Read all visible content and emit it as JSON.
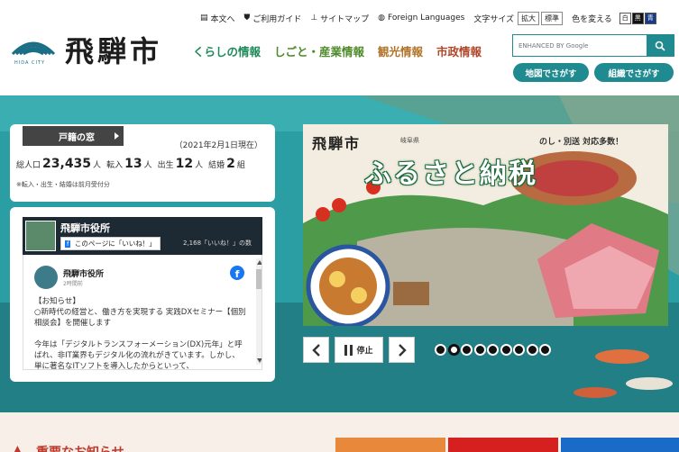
{
  "header": {
    "logo_text": "飛騨市",
    "logo_sub": "HIDA CITY",
    "util": {
      "text_link": "本文へ",
      "guide": "ご利用ガイド",
      "sitemap": "サイトマップ",
      "languages": "Foreign Languages",
      "font_size_label": "文字サイズ",
      "font_enlarge": "拡大",
      "font_standard": "標準",
      "color_label": "色を変える",
      "color_white": "白",
      "color_black": "黒",
      "color_blue": "青"
    },
    "nav": [
      {
        "label": "くらしの情報",
        "color": "#1f8a5a"
      },
      {
        "label": "しごと・産業情報",
        "color": "#4e8a2a"
      },
      {
        "label": "観光情報",
        "color": "#b0742a"
      },
      {
        "label": "市政情報",
        "color": "#b0462a"
      }
    ],
    "search": {
      "placeholder": "ENHANCED BY Google"
    },
    "map_search": "地図でさがす",
    "org_search": "組織でさがす"
  },
  "window": {
    "tab": "戸籍の窓",
    "date": "（2021年2月1日現在）",
    "population_label": "総人口",
    "population": "23,435",
    "population_unit": "人",
    "move_in_label": "転入",
    "move_in": "13",
    "move_in_unit": "人",
    "births_label": "出生",
    "births": "12",
    "births_unit": "人",
    "marriage_label": "結婚",
    "marriage": "2",
    "marriage_unit": "組",
    "note": "※転入・出生・結婚は前月受付分"
  },
  "facebook": {
    "page_name": "飛騨市役所",
    "like_button": "このページに「いいね！」",
    "like_count": "2,168「いいね！」の数",
    "post_page": "飛騨市役所",
    "post_time": "2時間前",
    "post_lines": [
      "【お知らせ】\n○新時代の経営と、働き方を実現する 実践DXセミナー【個別相談会】を開催します",
      "今年は「デジタルトランスフォーメーション(DX)元年」と呼ばれ、非IT業界もデジタル化の流れがきています。しかし、単に著名なITソフトを導入したからといって、"
    ]
  },
  "slider": {
    "logo": "飛騨市",
    "pref": "岐阜県",
    "tag": "のし・別送 対応多数！",
    "title": "ふるさと納税",
    "pause_label": "停止",
    "dot_count": 9,
    "active_dot": 2
  },
  "bottom": {
    "news_title": "重要なお知らせ"
  }
}
